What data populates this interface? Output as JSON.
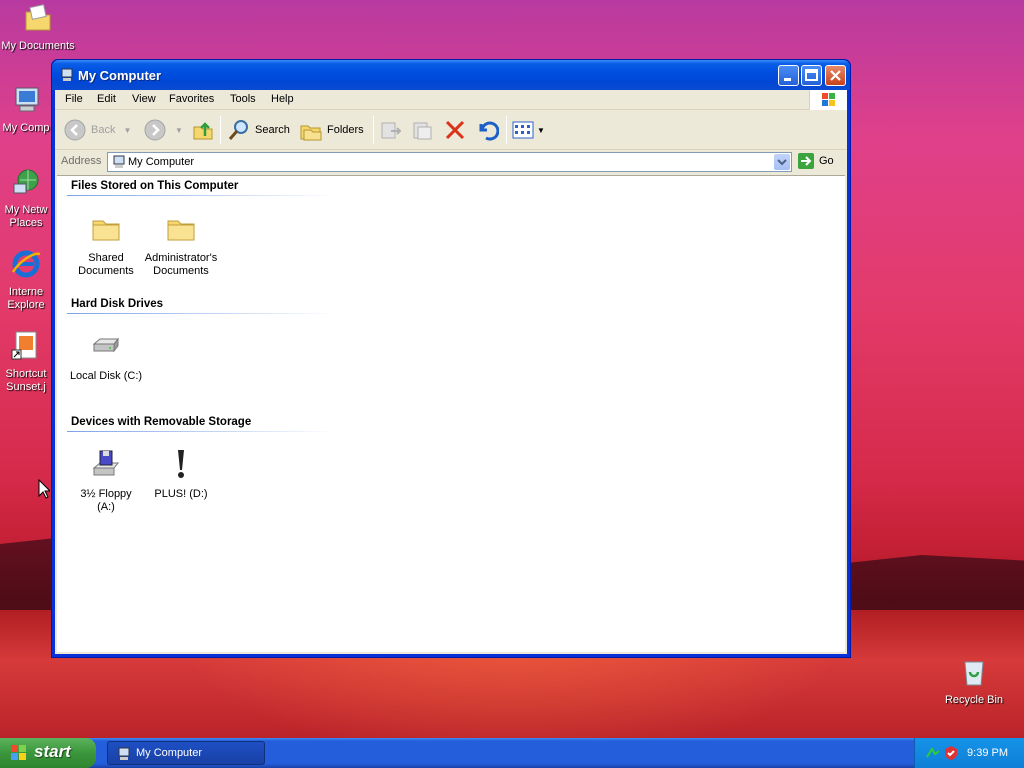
{
  "desktop": {
    "icons": [
      {
        "label": "My Documents",
        "icon": "my-documents-icon"
      },
      {
        "label": "My Comp",
        "icon": "my-computer-icon"
      },
      {
        "label": "My Netw",
        "label2": "Places",
        "icon": "network-places-icon"
      },
      {
        "label": "Interne",
        "label2": "Explore",
        "icon": "internet-explorer-icon"
      },
      {
        "label": "Shortcut",
        "label2": "Sunset.j",
        "icon": "shortcut-image-icon"
      }
    ],
    "recycle_bin": {
      "label": "Recycle Bin",
      "icon": "recycle-bin-icon"
    }
  },
  "window": {
    "title": "My Computer",
    "menu": [
      "File",
      "Edit",
      "View",
      "Favorites",
      "Tools",
      "Help"
    ],
    "toolbar": {
      "back": "Back",
      "search": "Search",
      "folders": "Folders"
    },
    "address": {
      "label": "Address",
      "value": "My Computer",
      "go": "Go"
    },
    "groups": [
      {
        "title": "Files Stored on This Computer",
        "items": [
          {
            "label": "Shared",
            "label2": "Documents",
            "icon": "folder-icon"
          },
          {
            "label": "Administrator's",
            "label2": "Documents",
            "icon": "folder-icon"
          }
        ]
      },
      {
        "title": "Hard Disk Drives",
        "items": [
          {
            "label": "Local Disk (C:)",
            "icon": "hard-disk-icon"
          }
        ]
      },
      {
        "title": "Devices with Removable Storage",
        "items": [
          {
            "label": "3½ Floppy",
            "label2": "(A:)",
            "icon": "floppy-drive-icon"
          },
          {
            "label": "PLUS! (D:)",
            "icon": "cd-drive-icon"
          }
        ]
      }
    ]
  },
  "taskbar": {
    "start": "start",
    "task": "My Computer",
    "clock": "9:39 PM"
  }
}
